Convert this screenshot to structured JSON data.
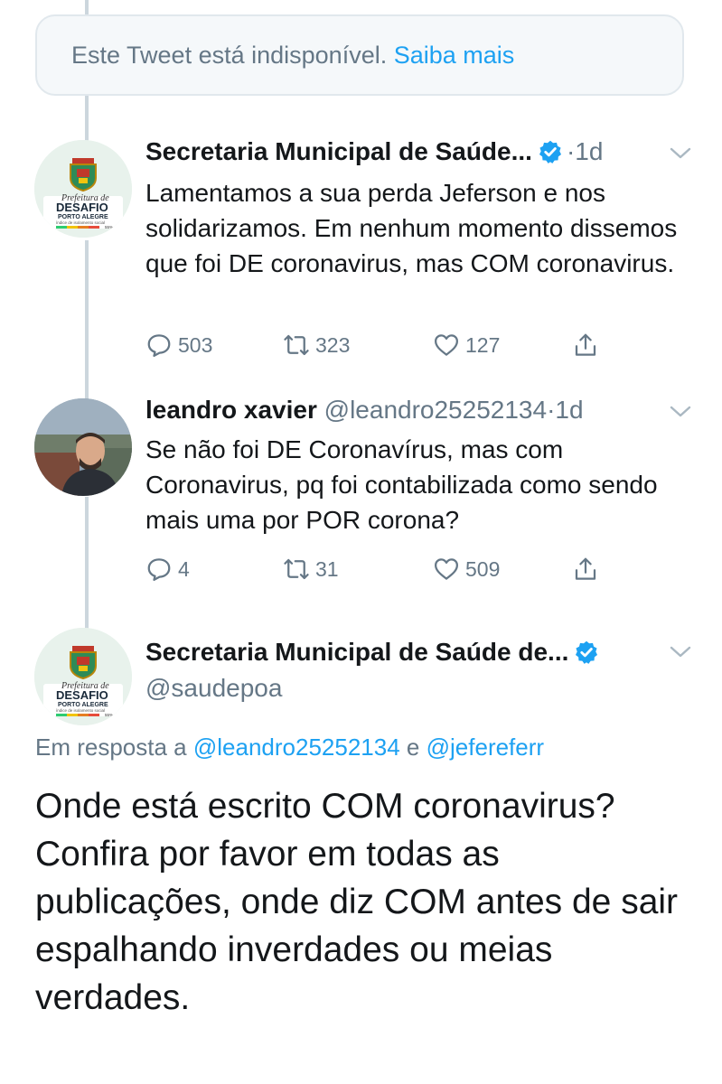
{
  "unavailable": {
    "text": "Este Tweet está indisponível.",
    "link": "Saiba mais"
  },
  "tweets": [
    {
      "name": "Secretaria Municipal de Saúde...",
      "separator": "·",
      "time": "1d",
      "verified": true,
      "avatar": {
        "type": "logo",
        "line1": "Prefeitura de",
        "line2": "DESAFIO",
        "line3": "PORTO ALEGRE",
        "line4": "índice de isolamento social",
        "line5": "55%"
      },
      "text": "Lamentamos a sua perda Jeferson e nos solidarizamos. Em nenhum momento dissemos que foi DE coronavirus, mas COM coronavirus.",
      "replies": "503",
      "retweets": "323",
      "likes": "127"
    },
    {
      "name": "leandro xavier",
      "handle": "@leandro25252134",
      "separator": "·",
      "time": "1d",
      "verified": false,
      "avatar": {
        "type": "photo"
      },
      "text": "Se não foi DE Coronavírus, mas com Coronavirus, pq foi contabilizada como sendo mais uma por POR corona?",
      "replies": "4",
      "retweets": "31",
      "likes": "509"
    }
  ],
  "main_tweet": {
    "name": "Secretaria Municipal de Saúde de...",
    "handle": "@saudepoa",
    "verified": true,
    "avatar": {
      "type": "logo",
      "line1": "Prefeitura de",
      "line2": "DESAFIO",
      "line3": "PORTO ALEGRE",
      "line4": "índice de isolamento social",
      "line5": "55%"
    },
    "reply_prefix": "Em resposta a",
    "mention1": "@leandro25252134",
    "conj": "e",
    "mention2": "@jefereferr",
    "text": "Onde está escrito COM coronavirus? Confira por favor em todas as publicações, onde diz COM antes de sair espalhando inverdades ou meias verdades."
  },
  "icons": {
    "reply": "reply-icon",
    "retweet": "retweet-icon",
    "like": "heart-icon",
    "share": "share-icon",
    "verified": "verified-badge-icon",
    "chevron": "chevron-down-icon"
  },
  "colors": {
    "accent": "#1da1f2",
    "muted": "#657786",
    "line": "#ccd6dd",
    "text": "#14171a"
  }
}
